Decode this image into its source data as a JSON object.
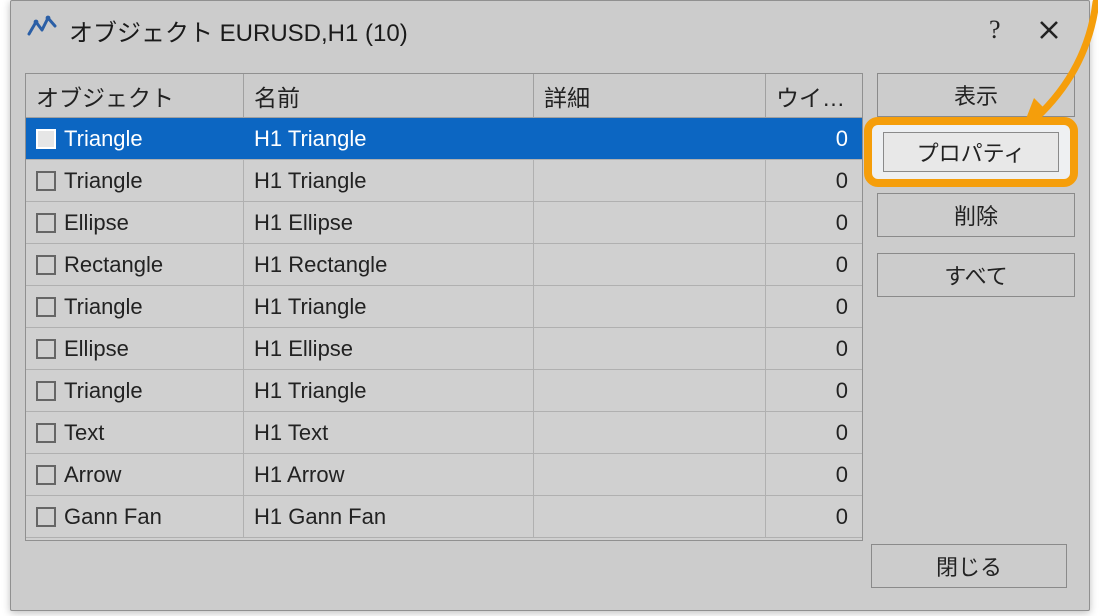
{
  "titlebar": {
    "title": "オブジェクト EURUSD,H1 (10)"
  },
  "headers": {
    "object": "オブジェクト",
    "name": "名前",
    "detail": "詳細",
    "wi": "ウイ…"
  },
  "rows": [
    {
      "object": "Triangle",
      "name": "H1 Triangle",
      "detail": "",
      "wi": "0",
      "selected": true
    },
    {
      "object": "Triangle",
      "name": "H1 Triangle",
      "detail": "",
      "wi": "0",
      "selected": false
    },
    {
      "object": "Ellipse",
      "name": "H1 Ellipse",
      "detail": "",
      "wi": "0",
      "selected": false
    },
    {
      "object": "Rectangle",
      "name": "H1 Rectangle",
      "detail": "",
      "wi": "0",
      "selected": false
    },
    {
      "object": "Triangle",
      "name": "H1 Triangle",
      "detail": "",
      "wi": "0",
      "selected": false
    },
    {
      "object": "Ellipse",
      "name": "H1 Ellipse",
      "detail": "",
      "wi": "0",
      "selected": false
    },
    {
      "object": "Triangle",
      "name": "H1 Triangle",
      "detail": "",
      "wi": "0",
      "selected": false
    },
    {
      "object": "Text",
      "name": "H1 Text",
      "detail": "",
      "wi": "0",
      "selected": false
    },
    {
      "object": "Arrow",
      "name": "H1 Arrow",
      "detail": "",
      "wi": "0",
      "selected": false
    },
    {
      "object": "Gann Fan",
      "name": "H1 Gann Fan",
      "detail": "",
      "wi": "0",
      "selected": false
    }
  ],
  "buttons": {
    "show": "表示",
    "properties": "プロパティ",
    "delete": "削除",
    "all": "すべて",
    "close": "閉じる"
  }
}
